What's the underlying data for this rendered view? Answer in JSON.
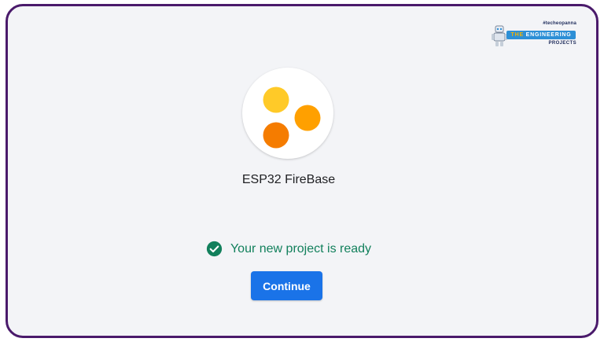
{
  "watermark": {
    "tag": "#techeopanna",
    "banner_prefix": "THE",
    "banner_main": "ENGINEERING",
    "sub": "PROJECTS"
  },
  "project": {
    "name": "ESP32 FireBase",
    "logo_icon": "firebase-project-dots-icon",
    "logo_colors": [
      "#ffca28",
      "#ffa000",
      "#f57c00"
    ]
  },
  "status": {
    "message": "Your new project is ready",
    "icon": "check-circle-icon",
    "color": "#12805c"
  },
  "actions": {
    "continue_label": "Continue",
    "accent": "#1a73e8"
  }
}
